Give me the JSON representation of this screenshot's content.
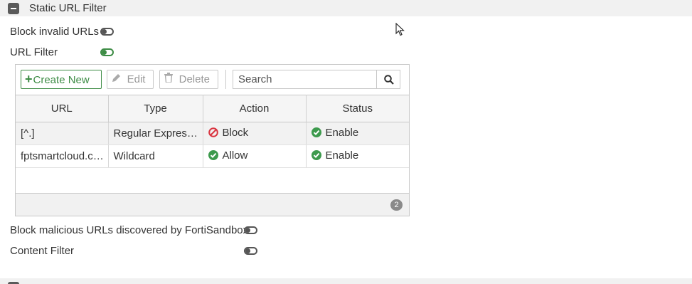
{
  "section": {
    "title": "Static URL Filter"
  },
  "settings": {
    "block_invalid_urls": {
      "label": "Block invalid URLs",
      "enabled": false
    },
    "url_filter": {
      "label": "URL Filter",
      "enabled": true
    },
    "block_malicious": {
      "label": "Block malicious URLs discovered by FortiSandbox",
      "enabled": false
    },
    "content_filter": {
      "label": "Content Filter",
      "enabled": false
    }
  },
  "toolbar": {
    "create_label": "Create New",
    "edit_label": "Edit",
    "delete_label": "Delete",
    "search_placeholder": "Search"
  },
  "table": {
    "columns": [
      "URL",
      "Type",
      "Action",
      "Status"
    ],
    "rows": [
      {
        "url": "[^.]",
        "type": "Regular Express…",
        "action": "Block",
        "action_kind": "block",
        "status": "Enable"
      },
      {
        "url": "fptsmartcloud.c…",
        "type": "Wildcard",
        "action": "Allow",
        "action_kind": "allow",
        "status": "Enable"
      }
    ],
    "count": "2"
  },
  "colors": {
    "accent_green": "#3d8c45",
    "block_red": "#d9333f",
    "enable_green": "#3d9a4d"
  }
}
